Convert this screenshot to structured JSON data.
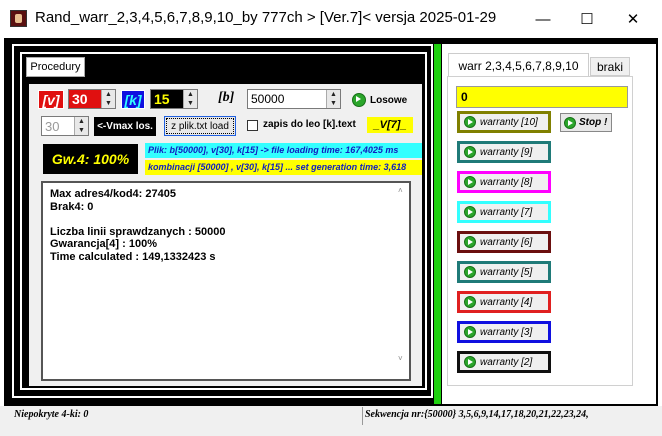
{
  "window": {
    "title": "Rand_warr_2,3,4,5,6,7,8,9,10_by 777ch > [Ver.7]<    versja 2025-01-29",
    "minimize": "—",
    "maximize": "☐",
    "close": "✕"
  },
  "left": {
    "tab": "Procedury",
    "v_label": "[v]",
    "v_value": "30",
    "k_label": "[k]",
    "k_value": "15",
    "b_label": "[b]",
    "b_value": "50000",
    "losowe": "Losowe",
    "vmax_value": "30",
    "vmax_button": "<-Vmax los.",
    "file_button": "z plik.txt load",
    "zapis_label": "zapis do leo [k].text",
    "version_tag": "_V[7]_",
    "gw_label": "Gw.4: 100%",
    "info_line1": "Plik: b[50000], v[30], k[15]  -> file loading time: 167,4025 ms",
    "info_line2": "kombinacji [50000] , v[30], k[15] ... set generation time: 3,618",
    "output": [
      "Max adres4/kod4: 27405",
      "Brak4: 0",
      "",
      "Liczba linii sprawdzanych : 50000",
      "Gwarancja[4] : 100%",
      "Time calculated : 149,1332423 s"
    ]
  },
  "right": {
    "tabs": [
      "warr 2,3,4,5,6,7,8,9,10",
      "braki"
    ],
    "display_value": "0",
    "stop_label": "Stop !",
    "buttons": [
      {
        "label": "warranty [10]",
        "color": "#808000"
      },
      {
        "label": "warranty [9]",
        "color": "#1f7a78"
      },
      {
        "label": "warranty [8]",
        "color": "#ff00ff"
      },
      {
        "label": "warranty [7]",
        "color": "#33ffff"
      },
      {
        "label": "warranty [6]",
        "color": "#6b0f0f"
      },
      {
        "label": "warranty [5]",
        "color": "#1f7a78"
      },
      {
        "label": "warranty [4]",
        "color": "#e02020"
      },
      {
        "label": "warranty [3]",
        "color": "#1010e0"
      },
      {
        "label": "warranty [2]",
        "color": "#101010"
      }
    ]
  },
  "status": {
    "left": "Niepokryte 4-ki: 0",
    "right": "Sekwencja nr:{50000}  3,5,6,9,14,17,18,20,21,22,23,24,"
  },
  "colors": {
    "accent_green": "#1fd10f",
    "yellow_display": "#ffff00",
    "cyan_info": "#33ffff",
    "red_label": "#e01010"
  }
}
